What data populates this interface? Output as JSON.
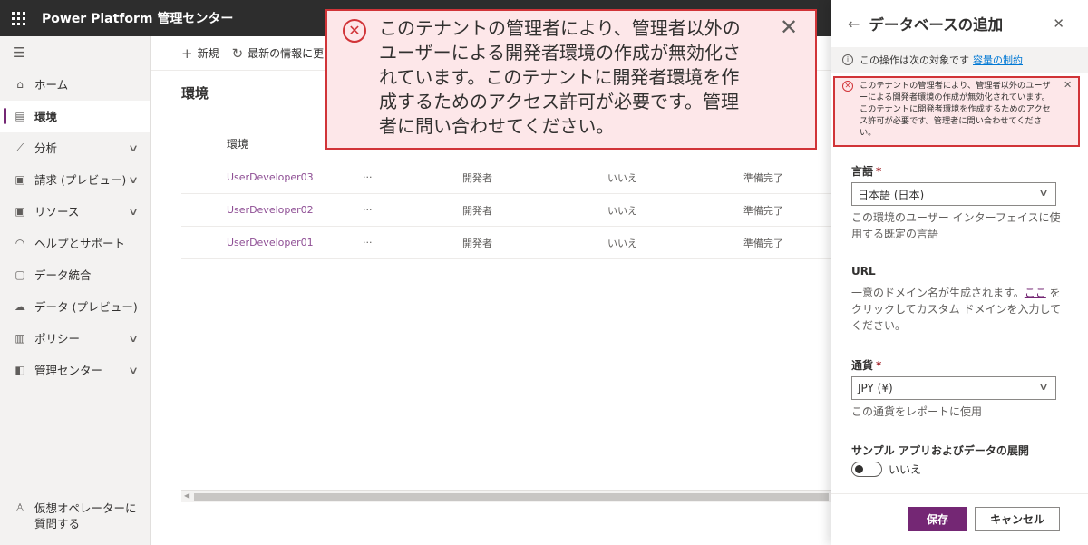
{
  "app": {
    "title": "Power Platform 管理センター"
  },
  "nav": {
    "items": [
      {
        "label": "ホーム",
        "icon": "⌂"
      },
      {
        "label": "環境",
        "icon": "▤"
      },
      {
        "label": "分析",
        "icon": "⟋"
      },
      {
        "label": "請求 (プレビュー)",
        "icon": "▣"
      },
      {
        "label": "リソース",
        "icon": "▣"
      },
      {
        "label": "ヘルプとサポート",
        "icon": "◠"
      },
      {
        "label": "データ統合",
        "icon": "▢"
      },
      {
        "label": "データ (プレビュー)",
        "icon": "☁"
      },
      {
        "label": "ポリシー",
        "icon": "▥"
      },
      {
        "label": "管理センター",
        "icon": "◧"
      }
    ],
    "bottom": {
      "label": "仮想オペレーターに質問する",
      "icon": "♙"
    }
  },
  "cmdbar": {
    "new_label": "新規",
    "refresh_label": "最新の情報に更"
  },
  "main": {
    "title": "環境",
    "table": {
      "header": "環境",
      "rows": [
        {
          "name": "UserDeveloper03",
          "more": "···",
          "type": "開発者",
          "flag": "いいえ",
          "state": "準備完了"
        },
        {
          "name": "UserDeveloper02",
          "more": "···",
          "type": "開発者",
          "flag": "いいえ",
          "state": "準備完了"
        },
        {
          "name": "UserDeveloper01",
          "more": "···",
          "type": "開発者",
          "flag": "いいえ",
          "state": "準備完了"
        }
      ]
    }
  },
  "callout": {
    "message": "このテナントの管理者により、管理者以外のユーザーによる開発者環境の作成が無効化されています。このテナントに開発者環境を作成するためのアクセス許可が必要です。管理者に問い合わせてください。"
  },
  "panel": {
    "title": "データベースの追加",
    "info": {
      "text": "この操作は次の対象です",
      "link": "容量の制約"
    },
    "error": "このテナントの管理者により、管理者以外のユーザーによる開発者環境の作成が無効化されています。このテナントに開発者環境を作成するためのアクセス許可が必要です。管理者に問い合わせてください。",
    "language": {
      "label": "言語",
      "required": "*",
      "value": "日本語 (日本)",
      "help": "この環境のユーザー インターフェイスに使用する既定の言語"
    },
    "url": {
      "label": "URL",
      "help_before": "一意のドメイン名が生成されます。",
      "help_link": "ここ",
      "help_after": " をクリックしてカスタム ドメインを入力してください。"
    },
    "currency": {
      "label": "通貨",
      "required": "*",
      "value": "JPY (¥)",
      "help": "この通貨をレポートに使用"
    },
    "sample": {
      "label": "サンプル アプリおよびデータの展開",
      "toggle_text": "いいえ"
    },
    "save_label": "保存",
    "cancel_label": "キャンセル"
  },
  "colors": {
    "accent": "#742774",
    "error": "#d13438",
    "error_bg": "#fde7e9",
    "topbar": "#2d2d2d"
  }
}
